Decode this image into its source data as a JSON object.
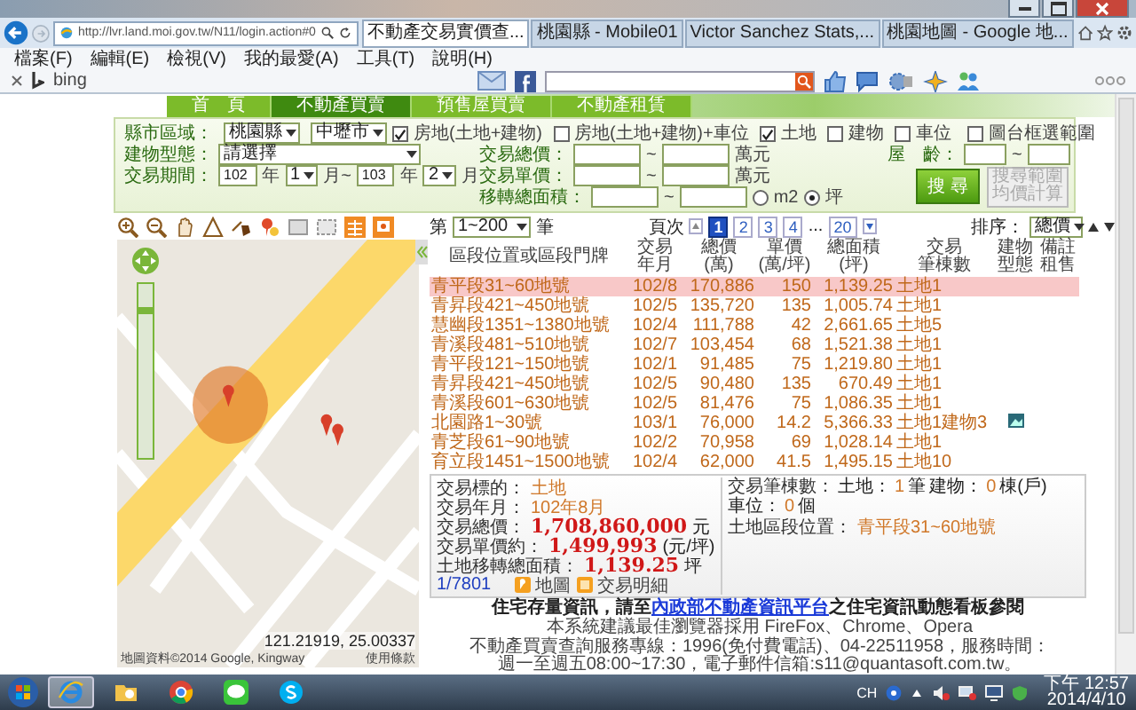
{
  "browser": {
    "address": "http://lvr.land.moi.gov.tw/N11/login.action#0",
    "tabs": [
      {
        "label": "不動產交易實價查...",
        "selected": true
      },
      {
        "label": "桃園縣 - Mobile01",
        "selected": false
      },
      {
        "label": "Victor Sanchez Stats,...",
        "selected": false
      },
      {
        "label": "桃園地圖 - Google 地...",
        "selected": false
      }
    ],
    "menu": [
      "檔案(F)",
      "編輯(E)",
      "檢視(V)",
      "我的最愛(A)",
      "工具(T)",
      "說明(H)"
    ],
    "toolbar_brand": "bing"
  },
  "site_nav": [
    {
      "label": "首　頁",
      "selected": false
    },
    {
      "label": "不動產買賣",
      "selected": true
    },
    {
      "label": "預售屋買賣",
      "selected": false
    },
    {
      "label": "不動產租賃",
      "selected": false
    }
  ],
  "search_form": {
    "region": {
      "label": "縣市區域：",
      "county": "桃園縣",
      "town": "中壢市"
    },
    "types": [
      {
        "label": "房地(土地+建物)",
        "checked": true
      },
      {
        "label": "房地(土地+建物)+車位",
        "checked": false
      },
      {
        "label": "土地",
        "checked": true
      },
      {
        "label": "建物",
        "checked": false
      },
      {
        "label": "車位",
        "checked": false
      }
    ],
    "map_select": {
      "label": "圖台框選範圍",
      "checked": false
    },
    "building_type": {
      "label": "建物型態：",
      "value": "請選擇"
    },
    "period": {
      "label": "交易期間：",
      "parts": [
        {
          "kind": "input",
          "text": "102"
        },
        {
          "kind": "text",
          "text": "年"
        },
        {
          "kind": "select",
          "text": "1"
        },
        {
          "kind": "text",
          "text": "月~"
        },
        {
          "kind": "input",
          "text": "103"
        },
        {
          "kind": "text",
          "text": "年"
        },
        {
          "kind": "select",
          "text": "2"
        },
        {
          "kind": "text",
          "text": "月"
        }
      ]
    },
    "ranges": [
      {
        "label": "交易總價：",
        "separator": "~",
        "unit": "萬元"
      },
      {
        "label": "交易單價：",
        "separator": "~",
        "unit": "萬元"
      },
      {
        "label": "移轉總面積：",
        "separator": "~",
        "units": [
          {
            "label": "m2",
            "selected": false
          },
          {
            "label": "坪",
            "selected": true
          }
        ]
      }
    ],
    "age": {
      "label": "屋　齡：",
      "separator": "~"
    },
    "search_button": "搜 尋",
    "average_button": {
      "label": "搜尋範圍均價計算",
      "disabled": true
    }
  },
  "map": {
    "zoom": {
      "level": 0.85
    },
    "coordinates": "121.21919, 25.00337",
    "copyright": "地圖資料©2014 Google, Kingway",
    "terms": "使用條款"
  },
  "results": {
    "pager": {
      "prefix": "第",
      "range": "1~200",
      "suffix": "筆",
      "pages_label": "頁次",
      "pages": [
        {
          "kind": "page",
          "label": "1",
          "selected": true
        },
        {
          "kind": "page",
          "label": "2",
          "selected": false
        },
        {
          "kind": "page",
          "label": "3",
          "selected": false
        },
        {
          "kind": "page",
          "label": "4",
          "selected": false
        },
        {
          "kind": "gap",
          "label": "..."
        },
        {
          "kind": "page",
          "label": "20",
          "selected": false
        }
      ],
      "sort_label": "排序：",
      "sort": "總價"
    },
    "columns": [
      [
        "區段位置或區段門牌"
      ],
      [
        "交易",
        "年月"
      ],
      [
        "總價",
        "(萬)"
      ],
      [
        "單價",
        "(萬/坪)"
      ],
      [
        "總面積",
        "(坪)"
      ],
      [
        "交易",
        "筆棟數"
      ],
      [
        "建物",
        "型態"
      ],
      [
        "備註",
        "租售"
      ]
    ],
    "rows": [
      {
        "location": "青平段31~60地號",
        "date": "102/8",
        "total": "170,886",
        "unit_price": "150",
        "area": "1,139.25",
        "count": "土地1",
        "photo": false,
        "selected": true
      },
      {
        "location": "青昇段421~450地號",
        "date": "102/5",
        "total": "135,720",
        "unit_price": "135",
        "area": "1,005.74",
        "count": "土地1",
        "photo": false,
        "selected": false
      },
      {
        "location": "慧幽段1351~1380地號",
        "date": "102/4",
        "total": "111,788",
        "unit_price": "42",
        "area": "2,661.65",
        "count": "土地5",
        "photo": false,
        "selected": false
      },
      {
        "location": "青溪段481~510地號",
        "date": "102/7",
        "total": "103,454",
        "unit_price": "68",
        "area": "1,521.38",
        "count": "土地1",
        "photo": false,
        "selected": false
      },
      {
        "location": "青平段121~150地號",
        "date": "102/1",
        "total": "91,485",
        "unit_price": "75",
        "area": "1,219.80",
        "count": "土地1",
        "photo": false,
        "selected": false
      },
      {
        "location": "青昇段421~450地號",
        "date": "102/5",
        "total": "90,480",
        "unit_price": "135",
        "area": "670.49",
        "count": "土地1",
        "photo": false,
        "selected": false
      },
      {
        "location": "青溪段601~630地號",
        "date": "102/5",
        "total": "81,476",
        "unit_price": "75",
        "area": "1,086.35",
        "count": "土地1",
        "photo": false,
        "selected": false
      },
      {
        "location": "北園路1~30號",
        "date": "103/1",
        "total": "76,000",
        "unit_price": "14.2",
        "area": "5,366.33",
        "count": "土地1建物3",
        "photo": true,
        "selected": false
      },
      {
        "location": "青芝段61~90地號",
        "date": "102/2",
        "total": "70,958",
        "unit_price": "69",
        "area": "1,028.14",
        "count": "土地1",
        "photo": false,
        "selected": false
      },
      {
        "location": "育立段1451~1500地號",
        "date": "102/4",
        "total": "62,000",
        "unit_price": "41.5",
        "area": "1,495.15",
        "count": "土地10",
        "photo": false,
        "selected": false
      }
    ]
  },
  "detail": {
    "fields": [
      {
        "kind": "plain",
        "label": "交易標的：",
        "value": "土地"
      },
      {
        "kind": "plain",
        "label": "交易年月：",
        "value": "102年8月"
      },
      {
        "kind": "big",
        "label": "交易總價：",
        "value": "1,708,860,000",
        "unit": "元"
      },
      {
        "kind": "big",
        "label": "交易單價約：",
        "value": "1,499,993",
        "unit": "(元/坪)"
      },
      {
        "kind": "big",
        "label": "土地移轉總面積：",
        "value": "1,139.25",
        "unit": "坪"
      }
    ],
    "counter": "1/7801",
    "links": [
      {
        "kind": "map",
        "label": "地圖"
      },
      {
        "kind": "detail",
        "label": "交易明細"
      }
    ],
    "count_label": "交易筆棟數：",
    "counts": [
      {
        "name": "土地：",
        "value": "1",
        "unit": "筆"
      },
      {
        "name": "建物：",
        "value": "0",
        "unit": "棟(戶)"
      },
      {
        "name": "車位：",
        "value": "0",
        "unit": "個"
      }
    ],
    "location_label": "土地區段位置：",
    "location": "青平段31~60地號"
  },
  "footer": {
    "notice": {
      "before": "住宅存量資訊，請至",
      "link": "內政部不動產資訊平台",
      "after": "之住宅資訊動態看板參閱"
    },
    "lines": [
      "本系統建議最佳瀏覽器採用 FireFox、Chrome、Opera",
      "不動產買賣查詢服務專線：1996(免付費電話)、04-22511958，服務時間：",
      "週一至週五08:00~17:30，電子郵件信箱:s11@quantasoft.com.tw。"
    ]
  },
  "taskbar": {
    "apps": [
      {
        "kind": "ie",
        "selected": true
      },
      {
        "kind": "folder",
        "selected": false
      },
      {
        "kind": "chrome",
        "selected": false
      },
      {
        "kind": "line",
        "selected": false
      },
      {
        "kind": "skype",
        "selected": false
      }
    ],
    "language": "CH",
    "time": "下午 12:57",
    "date": "2014/4/10"
  }
}
